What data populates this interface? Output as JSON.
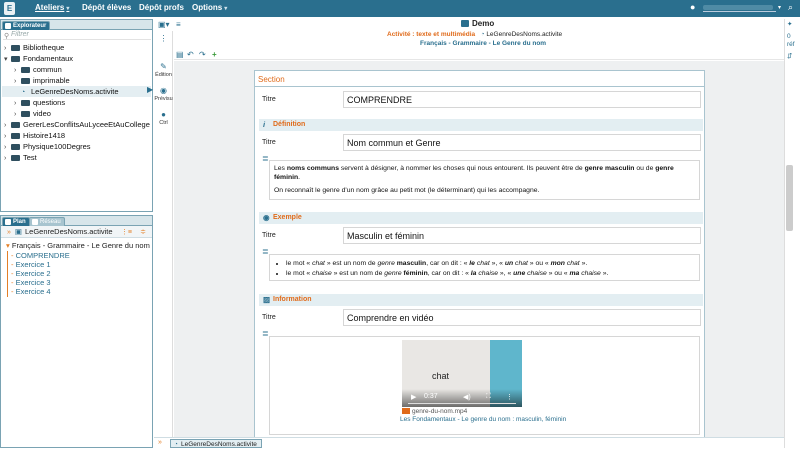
{
  "topbar": {
    "menus": [
      {
        "label": "Ateliers",
        "has_caret": true,
        "active": true
      },
      {
        "label": "Dépôt élèves",
        "has_caret": false,
        "active": false
      },
      {
        "label": "Dépôt profs",
        "has_caret": false,
        "active": false
      },
      {
        "label": "Options",
        "has_caret": true,
        "active": false
      }
    ],
    "logo_letter": "E"
  },
  "explorer": {
    "tab_label": "Explorateur",
    "filter_placeholder": "Filtrer",
    "items": [
      {
        "label": "Bibliotheque",
        "type": "folder",
        "depth": 0,
        "expanded": false
      },
      {
        "label": "Fondamentaux",
        "type": "folder",
        "depth": 0,
        "expanded": true
      },
      {
        "label": "commun",
        "type": "folder",
        "depth": 1,
        "expanded": false
      },
      {
        "label": "imprimable",
        "type": "folder",
        "depth": 1,
        "expanded": false
      },
      {
        "label": "LeGenreDesNoms.activite",
        "type": "file",
        "depth": 1,
        "selected": true
      },
      {
        "label": "questions",
        "type": "folder",
        "depth": 1,
        "expanded": false
      },
      {
        "label": "video",
        "type": "folder",
        "depth": 1,
        "expanded": false
      },
      {
        "label": "GererLesConflitsAuLyceeEtAuCollege",
        "type": "folder",
        "depth": 0,
        "expanded": false
      },
      {
        "label": "Histoire1418",
        "type": "folder",
        "depth": 0,
        "expanded": false
      },
      {
        "label": "Physique100Degres",
        "type": "folder",
        "depth": 0,
        "expanded": false
      },
      {
        "label": "Test",
        "type": "folder",
        "depth": 0,
        "expanded": false
      }
    ]
  },
  "plan": {
    "tabs": [
      "Plan",
      "Réseau"
    ],
    "file_label": "LeGenreDesNoms.activite",
    "root": "Français - Grammaire - Le Genre du nom",
    "children": [
      "COMPRENDRE",
      "Exercice 1",
      "Exercice 2",
      "Exercice 3",
      "Exercice 4"
    ]
  },
  "editor": {
    "tab_title": "Demo",
    "activity_type": "Activité : texte et multimédia",
    "file_name": "LeGenreDesNoms.activite",
    "subtitle": "Français - Grammaire - Le Genre du nom",
    "side_buttons": [
      "Édition",
      "Prévisu",
      "Ctrl"
    ],
    "right_rail": [
      "0",
      "réf"
    ]
  },
  "document": {
    "section_label": "Section",
    "title_label": "Titre",
    "section_title": "COMPRENDRE",
    "blocks": [
      {
        "kind": "Définition",
        "title": "Nom commun et Genre",
        "paragraphs": [
          "Les <b>noms communs</b> servent à désigner, à nommer les choses qui nous entourent. Ils peuvent être de <b>genre masculin</b> ou de <b>genre féminin</b>.",
          "On reconnaît le genre d'un nom grâce au petit mot (le déterminant) qui les accompagne."
        ]
      },
      {
        "kind": "Exemple",
        "title": "Masculin et féminin",
        "bullets": [
          "le mot « <i>chat</i> » est un nom de <i>genre</i> <b>masculin</b>, car on dit : « <b><i>le</i></b> <i>chat</i> », « <b><i>un</i></b> <i>chat</i> » ou « <b><i>mon</i></b> <i>chat</i> ».",
          "le mot « <i>chaise</i> » est un nom de <i>genre</i> <b>féminin</b>, car on dit : « <b><i>la</i></b> <i>chaise</i> », « <b><i>une</i></b> <i>chaise</i> » ou « <b><i>ma</i></b> <i>chaise</i> »."
        ]
      },
      {
        "kind": "Information",
        "title": "Comprendre en vidéo"
      }
    ],
    "video": {
      "overlay_text": "chat",
      "time": "0:37",
      "file_name": "genre-du-nom.mp4",
      "caption": "Les Fondamentaux - Le genre du nom : masculin, féminin"
    }
  },
  "bottom_tab": {
    "label": "LeGenreDesNoms.activite"
  },
  "colors": {
    "brand": "#2a6f8e",
    "accent": "#e06b1b",
    "folder": "#2f4f5f"
  }
}
